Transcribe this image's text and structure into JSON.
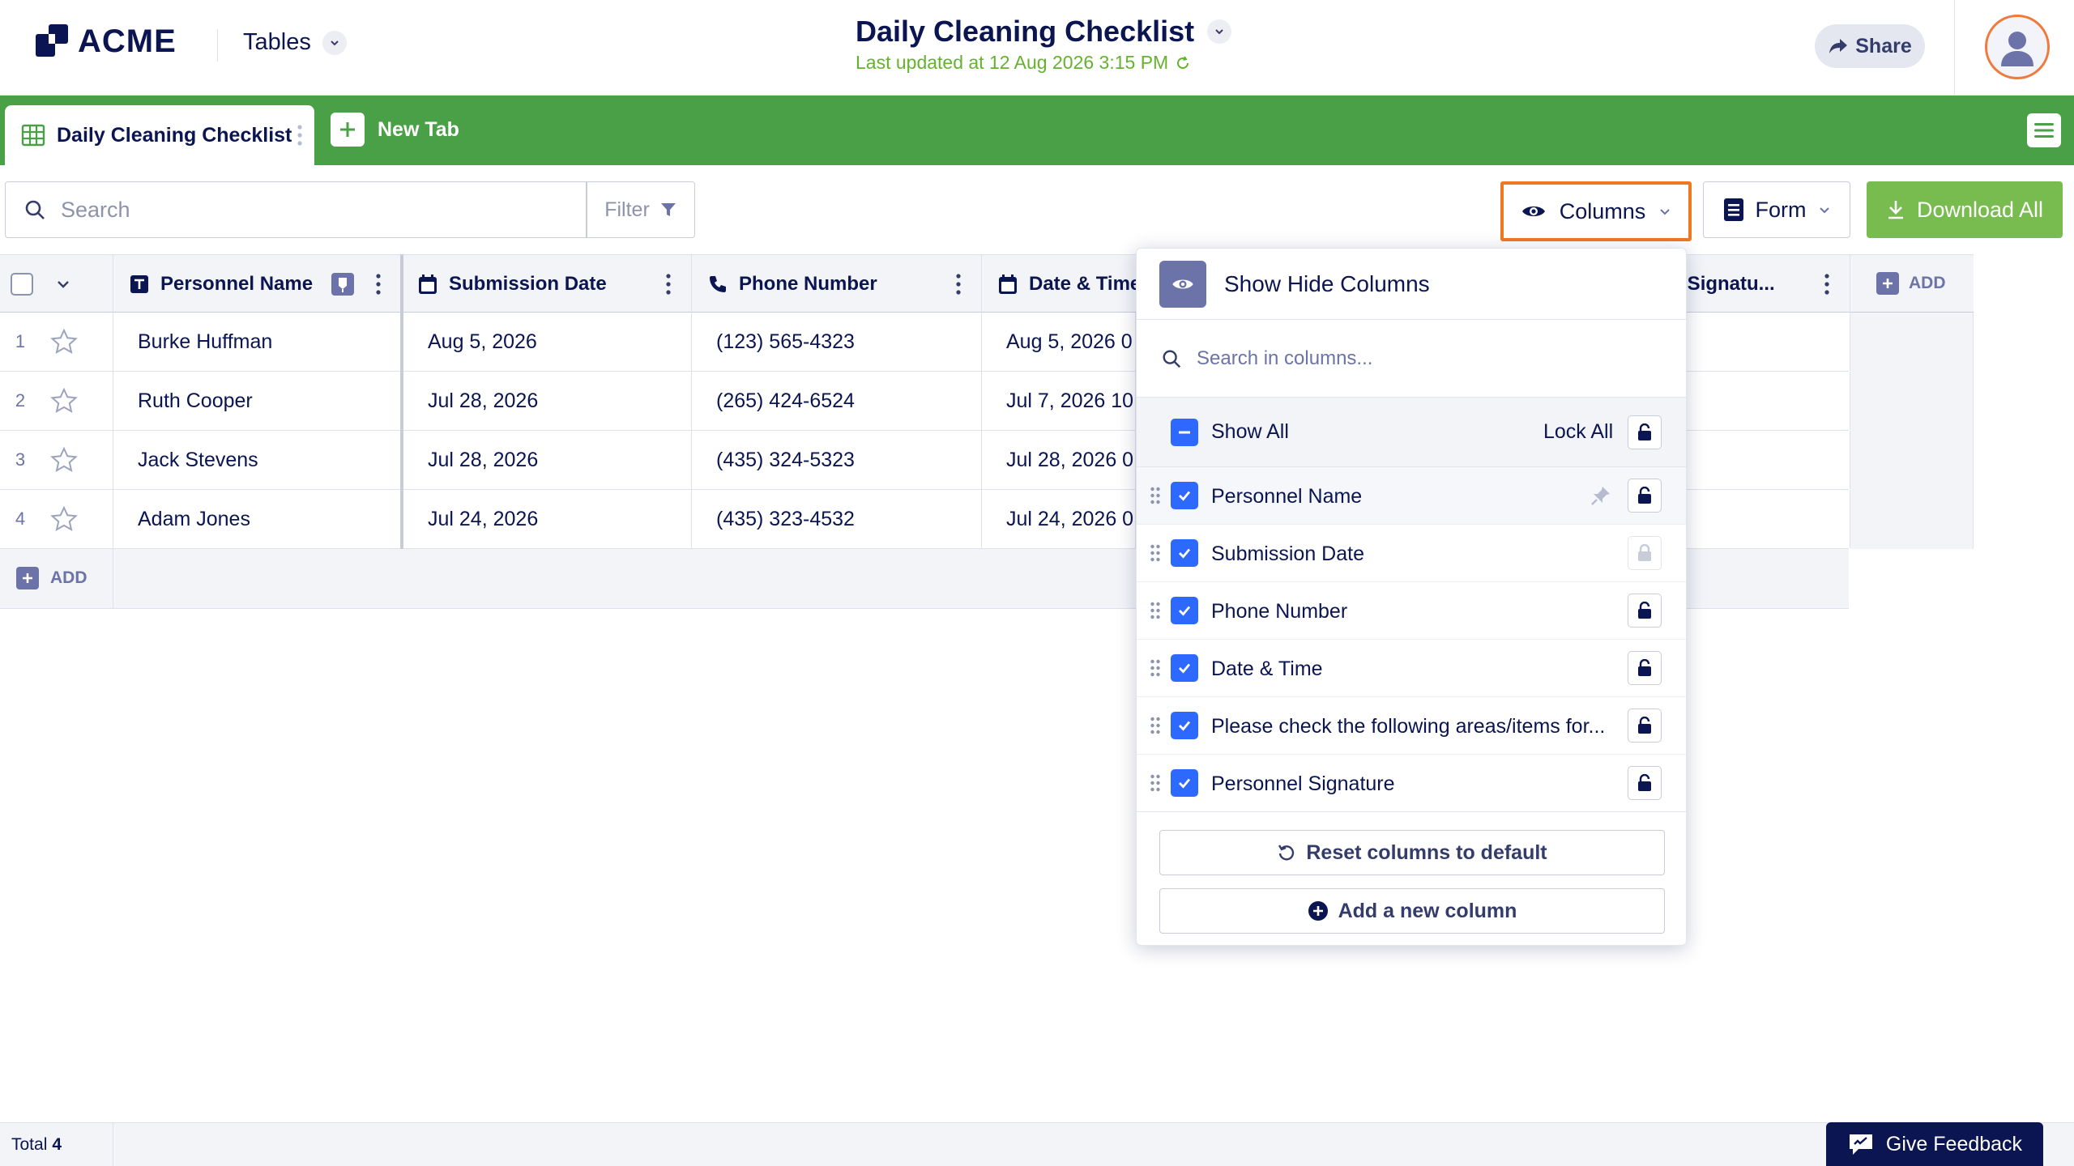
{
  "header": {
    "logo_text": "ACME",
    "section_label": "Tables",
    "title": "Daily Cleaning Checklist",
    "last_updated": "Last updated at 12 Aug 2026 3:15 PM",
    "share_label": "Share"
  },
  "tabs": {
    "items": [
      {
        "label": "Daily Cleaning Checklist",
        "active": true
      }
    ],
    "new_tab_label": "New Tab"
  },
  "toolbar": {
    "search_placeholder": "Search",
    "filter_label": "Filter",
    "columns_label": "Columns",
    "form_label": "Form",
    "download_label": "Download All"
  },
  "table": {
    "columns": [
      {
        "name": "Personnel Name",
        "icon": "text-icon"
      },
      {
        "name": "Submission Date",
        "icon": "calendar-icon"
      },
      {
        "name": "Phone Number",
        "icon": "phone-icon"
      },
      {
        "name": "Date & Time",
        "icon": "calendar-icon"
      },
      {
        "name": "el Signatu...",
        "icon": "signature-icon"
      }
    ],
    "rows": [
      {
        "num": "1",
        "name": "Burke Huffman",
        "submission": "Aug 5, 2026",
        "phone": "(123) 565-4323",
        "datetime": "Aug 5, 2026 0"
      },
      {
        "num": "2",
        "name": "Ruth Cooper",
        "submission": "Jul 28, 2026",
        "phone": "(265) 424-6524",
        "datetime": "Jul 7, 2026 10:"
      },
      {
        "num": "3",
        "name": "Jack Stevens",
        "submission": "Jul 28, 2026",
        "phone": "(435) 324-5323",
        "datetime": "Jul 28, 2026 0"
      },
      {
        "num": "4",
        "name": "Adam Jones",
        "submission": "Jul 24, 2026",
        "phone": "(435) 323-4532",
        "datetime": "Jul 24, 2026 0"
      }
    ],
    "add_row_label": "ADD",
    "add_column_label": "ADD"
  },
  "footer": {
    "total_label": "Total",
    "total_value": "4",
    "feedback_label": "Give Feedback"
  },
  "columns_popover": {
    "title": "Show Hide Columns",
    "search_placeholder": "Search in columns...",
    "show_all_label": "Show All",
    "lock_all_label": "Lock All",
    "items": [
      {
        "label": "Personnel Name",
        "checked": true,
        "pinned": true
      },
      {
        "label": "Submission Date",
        "checked": true,
        "lock_disabled": true
      },
      {
        "label": "Phone Number",
        "checked": true
      },
      {
        "label": "Date & Time",
        "checked": true
      },
      {
        "label": "Please check the following areas/items for...",
        "checked": true
      },
      {
        "label": "Personnel Signature",
        "checked": true
      }
    ],
    "reset_label": "Reset columns to default",
    "add_column_label": "Add a new column"
  },
  "colors": {
    "brand_navy": "#0a1551",
    "tab_green": "#4aa046",
    "download_green": "#78bb4f",
    "highlight_orange": "#f07822",
    "checkbox_blue": "#2e69ff",
    "updated_green": "#64b22d"
  }
}
